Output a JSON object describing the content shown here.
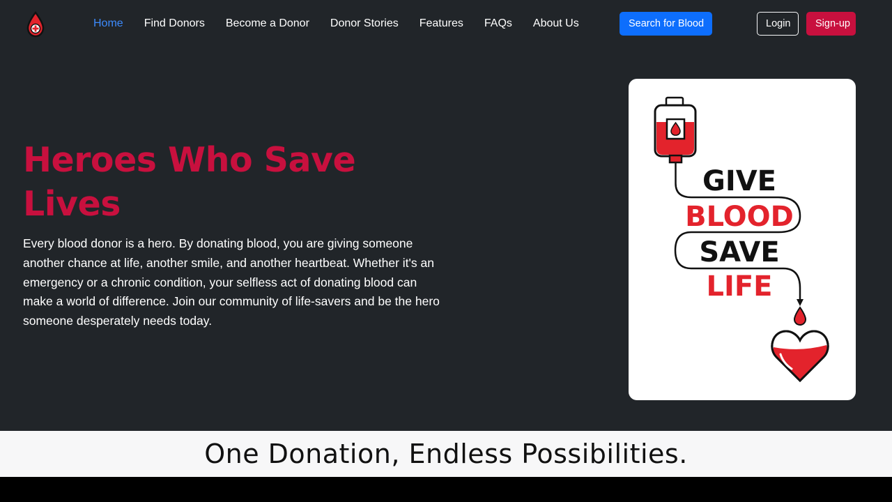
{
  "nav": {
    "links": [
      "Home",
      "Find Donors",
      "Become a Donor",
      "Donor Stories",
      "Features",
      "FAQs",
      "About Us"
    ],
    "active_index": 0,
    "search_label": "Search for Blood",
    "login_label": "Login",
    "signup_label": "Sign-up"
  },
  "hero": {
    "title": "Heroes Who Save Lives",
    "text": "Every blood donor is a hero. By donating blood, you are giving someone another chance at life, another smile, and another heartbeat. Whether it's an emergency or a chronic condition, your selfless act of donating blood can make a world of difference. Join our community of life-savers and be the hero someone desperately needs today.",
    "poster": {
      "line1": "GIVE",
      "line2": "BLOOD",
      "line3": "SAVE",
      "line4": "LIFE"
    }
  },
  "banner": {
    "text": "One Donation, Endless Possibilities."
  },
  "icons": {
    "logo": "blood-drop-plus-icon"
  },
  "colors": {
    "brand_red": "#c8103e",
    "primary_blue": "#0d6efd",
    "active_link": "#3d8bfd",
    "background": "#212529",
    "poster_red": "#e3232c"
  }
}
